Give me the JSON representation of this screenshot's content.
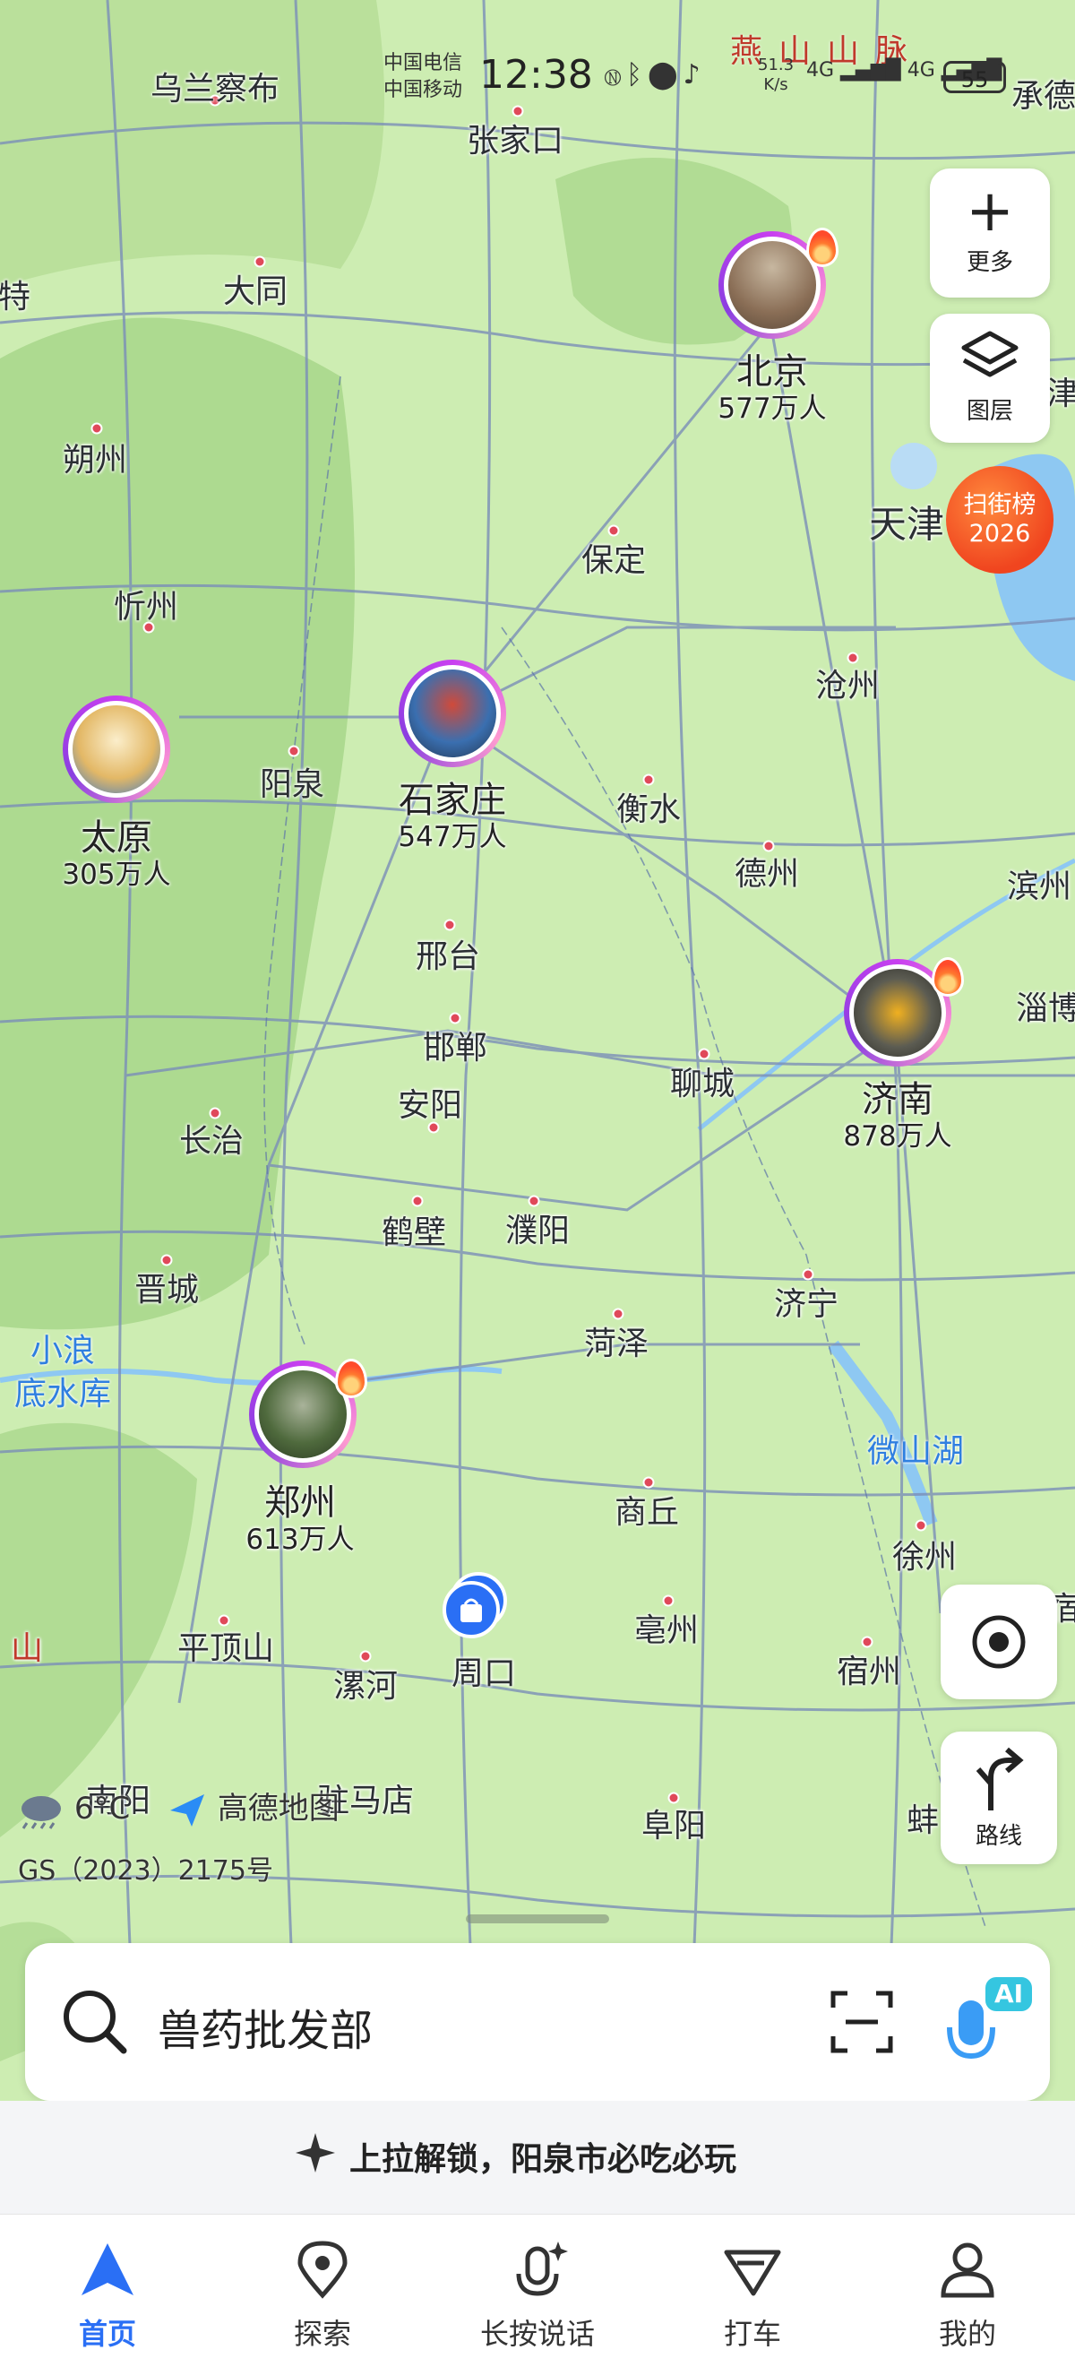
{
  "status_bar": {
    "carrier_1": "中国电信",
    "carrier_2": "中国移动",
    "time": "12:38",
    "speed_value": "51.3",
    "speed_unit": "K/s",
    "net_1": "4G",
    "net_2": "4G",
    "battery": "55"
  },
  "map": {
    "mountain_label": "燕山山脉",
    "cities": [
      {
        "name": "乌兰察布"
      },
      {
        "name": "张家口"
      },
      {
        "name": "承德"
      },
      {
        "name": "大同"
      },
      {
        "name": "特"
      },
      {
        "name": "朔州"
      },
      {
        "name": "保定"
      },
      {
        "name": "天津"
      },
      {
        "name": "津"
      },
      {
        "name": "忻州"
      },
      {
        "name": "沧州"
      },
      {
        "name": "阳泉"
      },
      {
        "name": "衡水"
      },
      {
        "name": "德州"
      },
      {
        "name": "滨州"
      },
      {
        "name": "邢台"
      },
      {
        "name": "邯郸"
      },
      {
        "name": "淄博"
      },
      {
        "name": "安阳"
      },
      {
        "name": "聊城"
      },
      {
        "name": "长治"
      },
      {
        "name": "鹤壁"
      },
      {
        "name": "濮阳"
      },
      {
        "name": "晋城"
      },
      {
        "name": "济宁"
      },
      {
        "name": "菏泽"
      },
      {
        "name": "商丘"
      },
      {
        "name": "徐州"
      },
      {
        "name": "平顶山"
      },
      {
        "name": "漯河"
      },
      {
        "name": "周口"
      },
      {
        "name": "亳州"
      },
      {
        "name": "宿州"
      },
      {
        "name": "宿"
      },
      {
        "name": "南阳"
      },
      {
        "name": "驻马店"
      },
      {
        "name": "阜阳"
      },
      {
        "name": "蚌"
      },
      {
        "name": "山"
      }
    ],
    "water_labels": {
      "reservoir_line1": "小浪",
      "reservoir_line2": "底水库",
      "lake": "微山湖"
    },
    "featured_cities": [
      {
        "name": "北京",
        "population": "577万人"
      },
      {
        "name": "石家庄",
        "population": "547万人"
      },
      {
        "name": "太原",
        "population": "305万人"
      },
      {
        "name": "济南",
        "population": "878万人"
      },
      {
        "name": "郑州",
        "population": "613万人"
      }
    ],
    "weather_temp": "6°C",
    "brand": "高德地图",
    "license": "GS（2023）2175号"
  },
  "controls": {
    "more_label": "更多",
    "layers_label": "图层",
    "ranking_line1": "扫街榜",
    "ranking_line2": "2026",
    "route_label": "路线"
  },
  "search": {
    "query": "兽药批发部",
    "ai_badge": "AI"
  },
  "promo": {
    "text": "上拉解锁，阳泉市必吃必玩"
  },
  "nav": {
    "items": [
      {
        "label": "首页"
      },
      {
        "label": "探索"
      },
      {
        "label": "长按说话"
      },
      {
        "label": "打车"
      },
      {
        "label": "我的"
      }
    ]
  },
  "colors": {
    "accent": "#2a6ff5",
    "map_land": "#ccebb0",
    "road": "#7b8fb8",
    "water": "#8ec8f2",
    "bubble_ring": "#c83ff0",
    "ranking_badge": "#f0451f"
  }
}
